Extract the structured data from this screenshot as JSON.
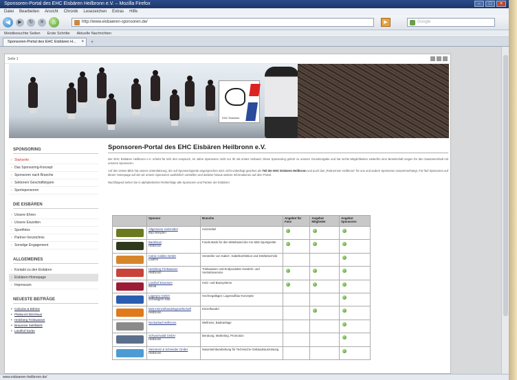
{
  "window": {
    "title": "Sponsoren-Portal des EHC Eisbären Heilbronn e.V. – Mozilla Firefox"
  },
  "menu": [
    "Datei",
    "Bearbeiten",
    "Ansicht",
    "Chronik",
    "Lesezeichen",
    "Extras",
    "Hilfe"
  ],
  "nav": {
    "url": "http://www.eisbaeren-sponsoren.de/",
    "search_placeholder": "Google"
  },
  "bookmarks": [
    "Meistbesuchte Seiten",
    "Erste Schritte",
    "Aktuelle Nachrichten"
  ],
  "tab": {
    "label": "Sponsoren-Portal des EHC Eisbären H..."
  },
  "page": {
    "toolbar_label": "Seite 1",
    "banner_logo_text": "EHC Eisbären",
    "title": "Sponsoren-Portal des EHC Eisbären Heilbronn e.V.",
    "intro": "Der EHC Eisbären Heilbronn e.V. erhebt für sich den Anspruch, im Jahre Sponsoren nicht nur Ihr als erstes Verband. Diese Sponsoring gehört zu unserer Grundvorgabe und hat nichts Möglichkeiten weiterhin eine Bereitschaft zeigen für den Zusammenhalt mit unseren Sponsoren.",
    "para2_a": "Auf den ersten Blick hat unsere Unterstützung, der auf Sponsoringseite angesprochen wird, nicht unbedingt gesehen als ",
    "para2_b": "Teil der EHC Eisbären Heilbronn",
    "para2_c": " und auch das „Partnernetz Heilbronn“ für uns und andere Sponsoren zusammenhängt. Für fünf Sponsoren auf dieser Homepage auf der wir unsere Sponsoren ausführlich vorstellen und darüber hinaus weitere Informationen auf dem Portal.",
    "para3": "Nachfolgend sehen Sie in alphabetischer Reihenfolge alle Sponsoren und Partner der Eisbären:"
  },
  "sidebar": {
    "sections": [
      {
        "heading": "SPONSORING",
        "items": [
          "Startseite",
          "Das Sponsoring-Konzept",
          "Sponsoren nach Branche",
          "Sektoren/ Geschäftstypen",
          "Sportsponsoren"
        ]
      },
      {
        "heading": "DIE EISBÄREN",
        "items": [
          "Unsere Ehren",
          "Unsere Eiszeiten",
          "Sportfotos",
          "Partner-Verzeichnis",
          "Sonstige Engagement"
        ]
      },
      {
        "heading": "ALLGEMEINES",
        "items": [
          "Kontakt zu den Eisbären",
          "Eisbären-Homepage",
          "Impressum"
        ]
      }
    ],
    "news_heading": "NEUESTE BEITRÄGE",
    "news": [
      "Calculus & Böhme",
      "Plattwurst Bürohaus",
      "Heitzberg Trinkwasser",
      "Brauereie Sektfabrik",
      "Landhof Dorbe"
    ]
  },
  "table": {
    "headers": [
      "",
      "Sponsor",
      "Branche",
      "Angebot für Fans",
      "Angebot Mitglieder",
      "Angebot Sponsoren"
    ],
    "rows": [
      {
        "logo_color": "#6b7a1e",
        "name": "Allgemeine Holzmöbel",
        "city": "Bad Wimpfen",
        "branche": "Holzmöbel",
        "fans": true,
        "members": true,
        "sponsors": true
      },
      {
        "logo_color": "#2f3a1d",
        "name": "Bankhaus",
        "city": "Heilbronn",
        "branche": "Fonds-Bank für den Mittelstand der Ins SBS Sportgeräte",
        "fans": true,
        "members": true,
        "sponsors": true
      },
      {
        "logo_color": "#d7852b",
        "name": "Calnic Cables GmbH",
        "city": "Lauffen",
        "branche": "Hersteller von Kabel-, Kabelkonfektion und Drähtetechnik",
        "fans": false,
        "members": false,
        "sponsors": true
      },
      {
        "logo_color": "#c7433b",
        "name": "Heitzberg Trinkwasser",
        "city": "Heilbronn",
        "branche": "Trinkwasser und Endprodukte Handels- und Vertriebsservice",
        "fans": true,
        "members": true,
        "sponsors": true
      },
      {
        "logo_color": "#9b1c34",
        "name": "Landhof Eisentore",
        "city": "Ilsfeld",
        "branche": "Holz- und Bausysteme",
        "fans": true,
        "members": true,
        "sponsors": true
      },
      {
        "logo_color": "#2a5db0",
        "name": "Lagerpro GmbH",
        "city": "Schwaigern-Süd",
        "branche": "Hochregallager, Lageraufbau-Konzepte",
        "fans": false,
        "members": false,
        "sponsors": true
      },
      {
        "logo_color": "#e07a1a",
        "name": "Metro-Einzelhandelsgesellschaft",
        "city": "Heilbronn",
        "branche": "Einzelhandel",
        "fans": false,
        "members": true,
        "sponsors": true
      },
      {
        "logo_color": "#8a8a8a",
        "name": "Neckarbad Heilbronn",
        "city": "",
        "branche": "Wellness, Badeanlage",
        "fans": false,
        "members": false,
        "sponsors": true
      },
      {
        "logo_color": "#5a6f8c",
        "name": "Schwarzwald GmbH",
        "city": "Heilbronn",
        "branche": "Beratung, Marketing, Promotion",
        "fans": false,
        "members": false,
        "sponsors": true
      },
      {
        "logo_color": "#4d9bd4",
        "name": "Steinmetz & Schneider GmbH",
        "city": "Heilbronn",
        "branche": "Natursteinbearbeitung für Technische Gebäudeausrüstung",
        "fans": false,
        "members": false,
        "sponsors": true
      }
    ]
  },
  "status": {
    "text": "www.eisbaeren-heilbronn.de/"
  }
}
